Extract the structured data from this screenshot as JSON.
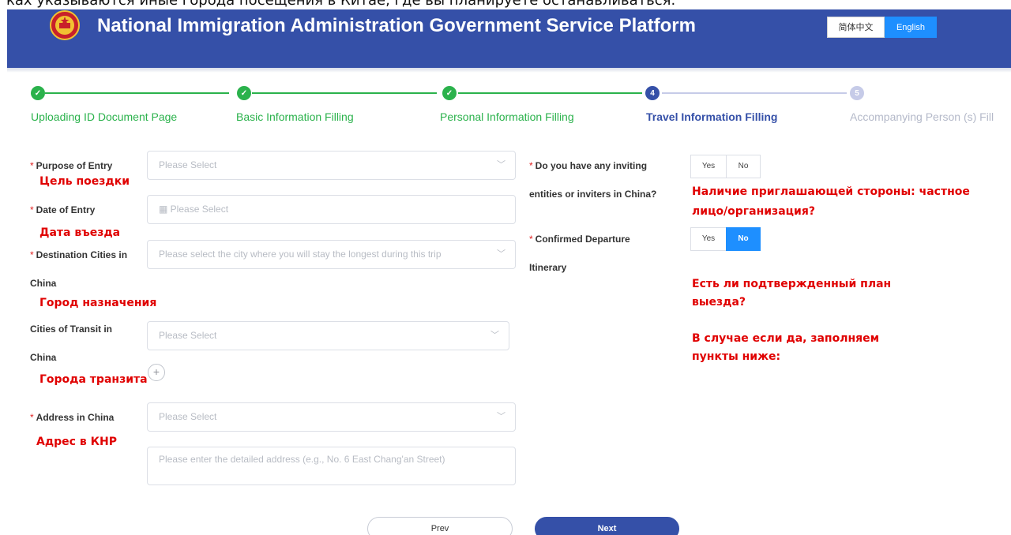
{
  "top_caption": "ках указываются иные города посещения в Китае, где вы планируете останавливаться.",
  "header": {
    "title": "National Immigration Administration Government Service Platform",
    "lang_cn": "简体中文",
    "lang_en": "English",
    "emblem_icon": "national-emblem-icon",
    "colors": {
      "bar": "#3550a8",
      "active_lang": "#1e8fff"
    }
  },
  "steps": [
    {
      "label": "Uploading ID Document Page",
      "state": "done",
      "mark": "✓"
    },
    {
      "label": "Basic Information Filling",
      "state": "done",
      "mark": "✓"
    },
    {
      "label": "Personal Information Filling",
      "state": "done",
      "mark": "✓"
    },
    {
      "label": "Travel Information Filling",
      "state": "current",
      "mark": "4"
    },
    {
      "label": "Accompanying Person (s) Fill",
      "state": "todo",
      "mark": "5"
    }
  ],
  "form": {
    "purpose": {
      "label": "Purpose of Entry",
      "placeholder": "Please Select",
      "note": "Цель поездки"
    },
    "date": {
      "label": "Date of Entry",
      "placeholder": "Please Select",
      "note": "Дата въезда"
    },
    "destination": {
      "label_1": "Destination Cities in",
      "label_2": "China",
      "placeholder": "Please select the city where you will stay the longest during this trip",
      "note": "Город назначения"
    },
    "transit": {
      "label_1": "Cities of Transit in",
      "label_2": "China",
      "placeholder": "Please Select",
      "note": "Города транзита"
    },
    "address": {
      "label": "Address in China",
      "placeholder": "Please Select",
      "detail_placeholder": "Please enter the detailed address (e.g., No. 6 East Chang'an Street)",
      "note": "Адрес в КНР"
    },
    "inviting": {
      "label_1": "Do you have any inviting",
      "label_2": "entities or inviters in China?",
      "yes": "Yes",
      "no": "No",
      "selected": "none",
      "note_1": "Наличие приглашающей стороны: частное",
      "note_2": "лицо/организация?"
    },
    "departure": {
      "label_1": "Confirmed Departure",
      "label_2": "Itinerary",
      "yes": "Yes",
      "no": "No",
      "selected": "No",
      "note_1": "Есть ли подтвержденный план",
      "note_2": "выезда?",
      "note_3": "В случае если да, заполняем",
      "note_4": "пункты ниже:"
    }
  },
  "icons": {
    "dropdown": "chevron-down-icon",
    "calendar": "calendar-icon",
    "add": "plus-circle-icon"
  },
  "buttons": {
    "prev": "Prev",
    "next": "Next"
  }
}
